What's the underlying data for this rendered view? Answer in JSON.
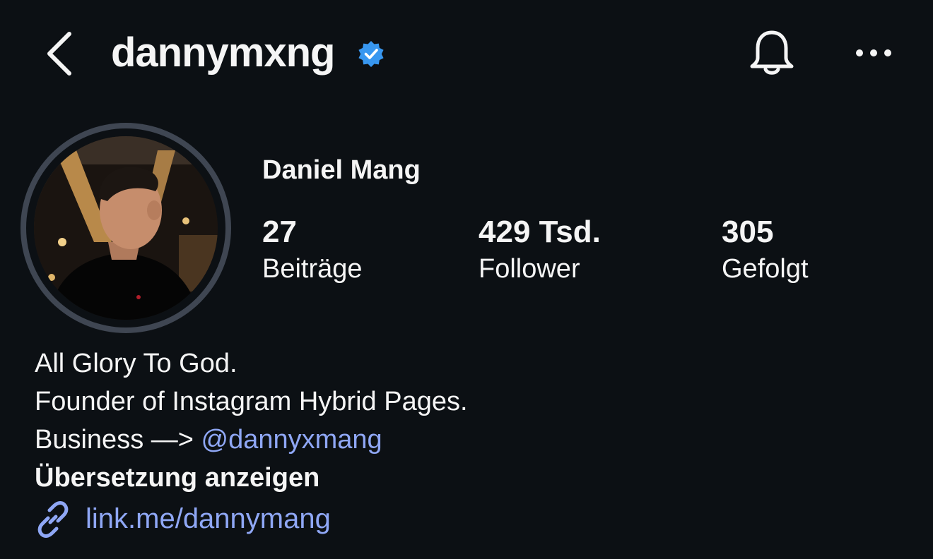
{
  "header": {
    "username": "dannymxng",
    "back_icon": "chevron-left-icon",
    "verified_icon": "verified-badge-icon",
    "notifications_icon": "bell-icon",
    "more_icon": "more-horizontal-icon"
  },
  "profile": {
    "full_name": "Daniel Mang",
    "stats": [
      {
        "value": "27",
        "label": "Beiträge"
      },
      {
        "value": "429 Tsd.",
        "label": "Follower"
      },
      {
        "value": "305",
        "label": "Gefolgt"
      }
    ]
  },
  "bio": {
    "line1": "All Glory To God.",
    "line2": "Founder of Instagram Hybrid Pages.",
    "line3_prefix": "Business —> ",
    "line3_mention": "@dannyxmang",
    "translate": "Übersetzung anzeigen"
  },
  "link": {
    "icon": "link-icon",
    "text": "link.me/dannymang"
  },
  "colors": {
    "background": "#0c1014",
    "text": "#f5f5f5",
    "link": "#8fa7f5",
    "verified": "#3897f0",
    "avatar_ring": "#3f4652"
  }
}
